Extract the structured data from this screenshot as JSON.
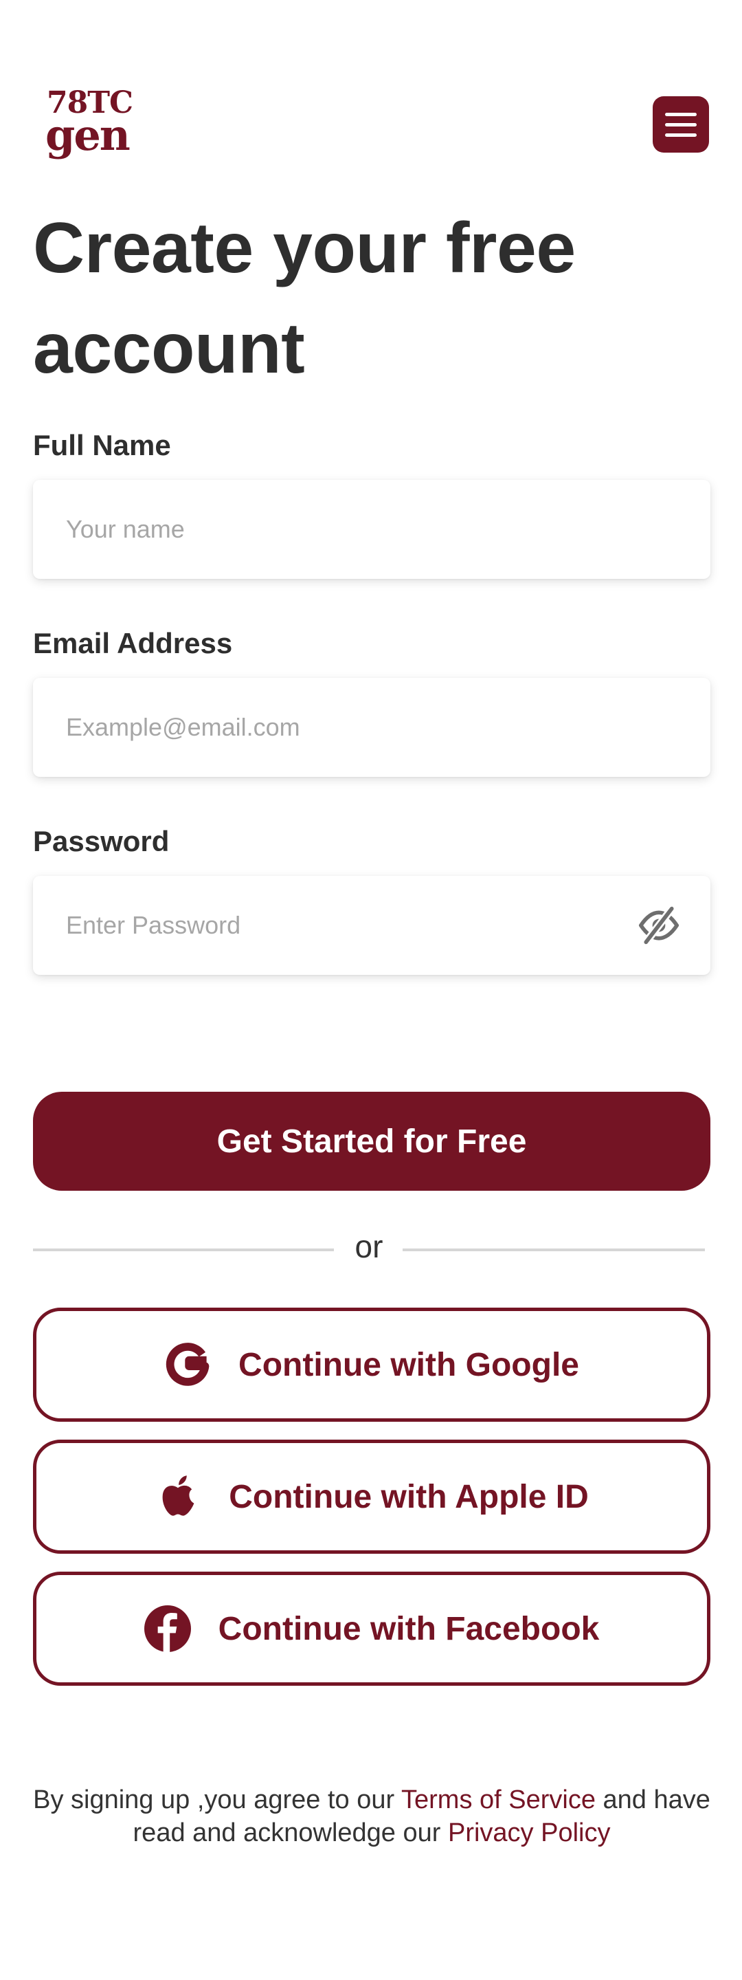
{
  "brand": {
    "logo_line1": "78TC",
    "logo_line2": "gen",
    "accent_color": "#741424"
  },
  "header": {
    "menu_icon": "hamburger-menu-icon"
  },
  "page": {
    "title_line1": "Create your free",
    "title_line2": "account"
  },
  "form": {
    "full_name": {
      "label": "Full Name",
      "placeholder": "Your name",
      "value": ""
    },
    "email": {
      "label": "Email Address",
      "placeholder": "Example@email.com",
      "value": ""
    },
    "password": {
      "label": "Password",
      "placeholder": "Enter Password",
      "value": "",
      "toggle_icon": "eye-off-icon"
    },
    "submit_label": "Get Started for Free"
  },
  "divider": {
    "text": "or"
  },
  "social": [
    {
      "label": "Continue with Google",
      "icon": "google-icon"
    },
    {
      "label": "Continue with Apple ID",
      "icon": "apple-icon"
    },
    {
      "label": "Continue with Facebook",
      "icon": "facebook-icon"
    }
  ],
  "footer": {
    "text_1": "By signing up ,you agree to our ",
    "terms_link": "Terms of Service",
    "text_2": " and have read and acknowledge our ",
    "privacy_link": "Privacy Policy"
  }
}
